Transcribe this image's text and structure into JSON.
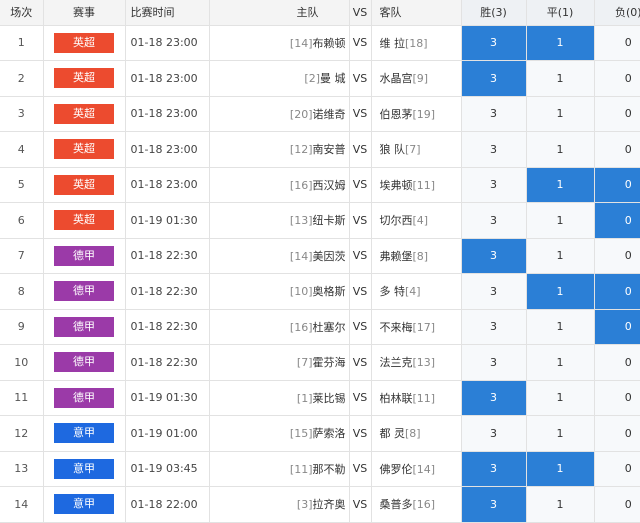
{
  "header": {
    "no": "场次",
    "league": "赛事",
    "time": "比赛时间",
    "home": "主队",
    "vs": "VS",
    "away": "客队",
    "win": "胜(3)",
    "draw": "平(1)",
    "lose": "负(0)"
  },
  "colors": {
    "yingchao": "#ec4b2f",
    "dejia": "#9b3aa8",
    "yijia": "#1e69e0",
    "selected": "#2b7fd6"
  },
  "matches": [
    {
      "no": "1",
      "league": "英超",
      "league_key": "yingchao",
      "time": "01-18 23:00",
      "home_rank": "[14]",
      "home": "布赖顿",
      "vs": "VS",
      "away": "维 拉",
      "away_rank": "[18]",
      "win": "3",
      "draw": "1",
      "lose": "0",
      "sel": [
        true,
        true,
        false
      ]
    },
    {
      "no": "2",
      "league": "英超",
      "league_key": "yingchao",
      "time": "01-18 23:00",
      "home_rank": "[2]",
      "home": "曼 城",
      "vs": "VS",
      "away": "水晶宫",
      "away_rank": "[9]",
      "win": "3",
      "draw": "1",
      "lose": "0",
      "sel": [
        true,
        false,
        false
      ]
    },
    {
      "no": "3",
      "league": "英超",
      "league_key": "yingchao",
      "time": "01-18 23:00",
      "home_rank": "[20]",
      "home": "诺维奇",
      "vs": "VS",
      "away": "伯恩茅",
      "away_rank": "[19]",
      "win": "3",
      "draw": "1",
      "lose": "0",
      "sel": [
        false,
        false,
        false
      ]
    },
    {
      "no": "4",
      "league": "英超",
      "league_key": "yingchao",
      "time": "01-18 23:00",
      "home_rank": "[12]",
      "home": "南安普",
      "vs": "VS",
      "away": "狼 队",
      "away_rank": "[7]",
      "win": "3",
      "draw": "1",
      "lose": "0",
      "sel": [
        false,
        false,
        false
      ]
    },
    {
      "no": "5",
      "league": "英超",
      "league_key": "yingchao",
      "time": "01-18 23:00",
      "home_rank": "[16]",
      "home": "西汉姆",
      "vs": "VS",
      "away": "埃弗顿",
      "away_rank": "[11]",
      "win": "3",
      "draw": "1",
      "lose": "0",
      "sel": [
        false,
        true,
        true
      ]
    },
    {
      "no": "6",
      "league": "英超",
      "league_key": "yingchao",
      "time": "01-19 01:30",
      "home_rank": "[13]",
      "home": "纽卡斯",
      "vs": "VS",
      "away": "切尔西",
      "away_rank": "[4]",
      "win": "3",
      "draw": "1",
      "lose": "0",
      "sel": [
        false,
        false,
        true
      ]
    },
    {
      "no": "7",
      "league": "德甲",
      "league_key": "dejia",
      "time": "01-18 22:30",
      "home_rank": "[14]",
      "home": "美因茨",
      "vs": "VS",
      "away": "弗赖堡",
      "away_rank": "[8]",
      "win": "3",
      "draw": "1",
      "lose": "0",
      "sel": [
        true,
        false,
        false
      ]
    },
    {
      "no": "8",
      "league": "德甲",
      "league_key": "dejia",
      "time": "01-18 22:30",
      "home_rank": "[10]",
      "home": "奥格斯",
      "vs": "VS",
      "away": "多 特",
      "away_rank": "[4]",
      "win": "3",
      "draw": "1",
      "lose": "0",
      "sel": [
        false,
        true,
        true
      ]
    },
    {
      "no": "9",
      "league": "德甲",
      "league_key": "dejia",
      "time": "01-18 22:30",
      "home_rank": "[16]",
      "home": "杜塞尔",
      "vs": "VS",
      "away": "不来梅",
      "away_rank": "[17]",
      "win": "3",
      "draw": "1",
      "lose": "0",
      "sel": [
        false,
        false,
        true
      ]
    },
    {
      "no": "10",
      "league": "德甲",
      "league_key": "dejia",
      "time": "01-18 22:30",
      "home_rank": "[7]",
      "home": "霍芬海",
      "vs": "VS",
      "away": "法兰克",
      "away_rank": "[13]",
      "win": "3",
      "draw": "1",
      "lose": "0",
      "sel": [
        false,
        false,
        false
      ]
    },
    {
      "no": "11",
      "league": "德甲",
      "league_key": "dejia",
      "time": "01-19 01:30",
      "home_rank": "[1]",
      "home": "莱比锡",
      "vs": "VS",
      "away": "柏林联",
      "away_rank": "[11]",
      "win": "3",
      "draw": "1",
      "lose": "0",
      "sel": [
        true,
        false,
        false
      ]
    },
    {
      "no": "12",
      "league": "意甲",
      "league_key": "yijia",
      "time": "01-19 01:00",
      "home_rank": "[15]",
      "home": "萨索洛",
      "vs": "VS",
      "away": "都 灵",
      "away_rank": "[8]",
      "win": "3",
      "draw": "1",
      "lose": "0",
      "sel": [
        false,
        false,
        false
      ]
    },
    {
      "no": "13",
      "league": "意甲",
      "league_key": "yijia",
      "time": "01-19 03:45",
      "home_rank": "[11]",
      "home": "那不勒",
      "vs": "VS",
      "away": "佛罗伦",
      "away_rank": "[14]",
      "win": "3",
      "draw": "1",
      "lose": "0",
      "sel": [
        true,
        true,
        false
      ]
    },
    {
      "no": "14",
      "league": "意甲",
      "league_key": "yijia",
      "time": "01-18 22:00",
      "home_rank": "[3]",
      "home": "拉齐奥",
      "vs": "VS",
      "away": "桑普多",
      "away_rank": "[16]",
      "win": "3",
      "draw": "1",
      "lose": "0",
      "sel": [
        true,
        false,
        false
      ]
    }
  ]
}
